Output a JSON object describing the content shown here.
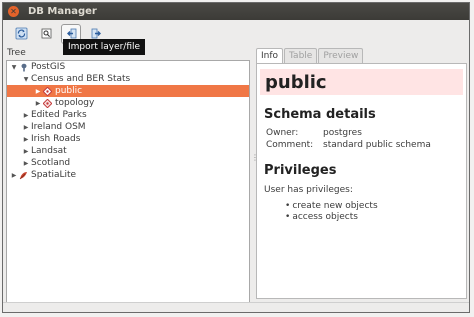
{
  "window": {
    "title": "DB Manager"
  },
  "toolbar": {
    "tooltip": "Import layer/file",
    "buttons": [
      {
        "icon": "refresh-icon"
      },
      {
        "icon": "sql-window-icon"
      },
      {
        "icon": "import-layer-icon"
      },
      {
        "icon": "export-layer-icon"
      }
    ]
  },
  "tree": {
    "label": "Tree",
    "nodes": [
      {
        "label": "PostGIS",
        "icon": "postgis-elephant-icon",
        "expanded": true
      },
      {
        "label": "Census and BER Stats",
        "expanded": true
      },
      {
        "label": "public",
        "icon": "schema-icon",
        "selected": true
      },
      {
        "label": "topology",
        "icon": "schema-icon"
      },
      {
        "label": "Edited Parks"
      },
      {
        "label": "Ireland OSM"
      },
      {
        "label": "Irish Roads"
      },
      {
        "label": "Landsat"
      },
      {
        "label": "Scotland"
      },
      {
        "label": "SpatiaLite",
        "icon": "spatialite-feather-icon"
      }
    ]
  },
  "tabs": [
    {
      "label": "Info",
      "active": true
    },
    {
      "label": "Table",
      "active": false
    },
    {
      "label": "Preview",
      "active": false
    }
  ],
  "info": {
    "schema_name": "public",
    "details_title": "Schema details",
    "owner_label": "Owner:",
    "owner_value": "postgres",
    "comment_label": "Comment:",
    "comment_value": "standard public schema",
    "privileges_title": "Privileges",
    "privileges_text": "User has privileges:",
    "privileges": [
      "create new objects",
      "access objects"
    ]
  },
  "colors": {
    "selection": "#f07746",
    "banner": "#ffe4e4",
    "titlebar": "#3c3b37",
    "close_button": "#e5632a"
  }
}
